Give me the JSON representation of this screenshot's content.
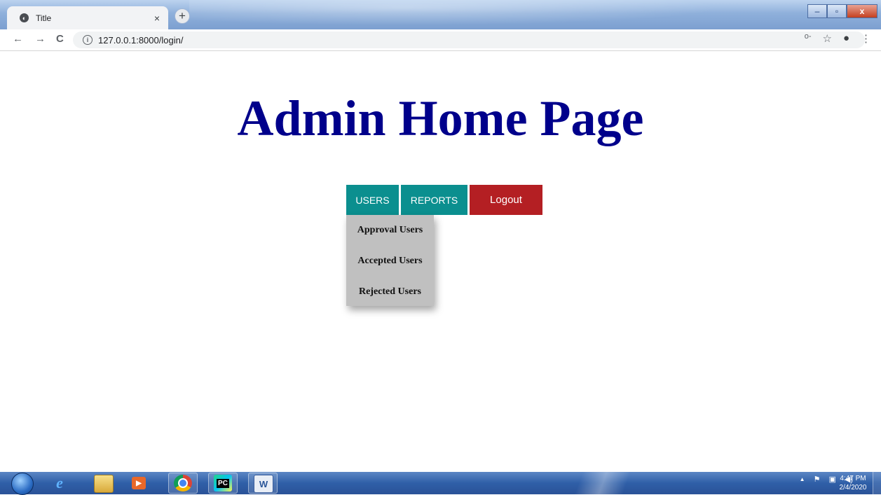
{
  "browser": {
    "tab_title": "Title",
    "tab_close": "×",
    "new_tab": "+",
    "url": "127.0.0.1:8000/login/",
    "back": "←",
    "forward": "→",
    "reload": "C",
    "key_icon": "o-",
    "star_icon": "☆",
    "account_icon": "●",
    "menu_icon": "⋮",
    "window_min": "–",
    "window_max": "▫",
    "window_close": "x"
  },
  "page": {
    "heading": "Admin Home Page",
    "nav": {
      "users": "USERS",
      "reports": "REPORTS",
      "logout": "Logout"
    },
    "users_menu": [
      "Approval Users",
      "Accepted Users",
      "Rejected Users"
    ]
  },
  "colors": {
    "heading": "#00008b",
    "nav_button": "#0b8f8f",
    "logout_button": "#b41f23",
    "dropdown_bg": "#c0c0c0"
  },
  "taskbar": {
    "apps": [
      "internet-explorer-icon",
      "file-explorer-icon",
      "media-player-icon",
      "chrome-icon",
      "pycharm-icon",
      "word-icon"
    ],
    "pycharm_label": "PC",
    "word_label": "W",
    "time": "4:47 PM",
    "date": "2/4/2020"
  }
}
